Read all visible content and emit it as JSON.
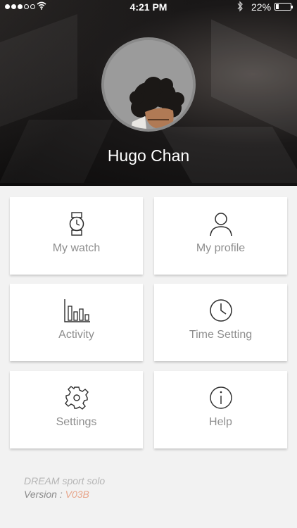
{
  "status_bar": {
    "time": "4:21 PM",
    "battery": "22%",
    "battery_level": 0.22,
    "signal_bars_filled": 3,
    "signal_bars_total": 5
  },
  "profile": {
    "name": "Hugo Chan"
  },
  "menu": [
    {
      "label": "My watch",
      "icon": "watch-icon"
    },
    {
      "label": "My profile",
      "icon": "person-icon"
    },
    {
      "label": "Activity",
      "icon": "bar-chart-icon"
    },
    {
      "label": "Time Setting",
      "icon": "clock-icon"
    },
    {
      "label": "Settings",
      "icon": "gear-icon"
    },
    {
      "label": "Help",
      "icon": "info-icon"
    }
  ],
  "footer": {
    "product": "DREAM sport solo",
    "version_label": "Version : ",
    "version": "V03B"
  },
  "colors": {
    "accent": "#e8a58a",
    "label": "#8e8e8e",
    "background": "#f2f2f2"
  }
}
